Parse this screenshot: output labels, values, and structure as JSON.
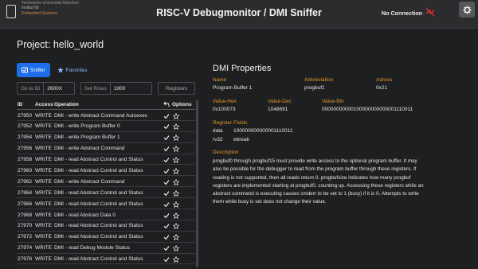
{
  "header": {
    "logo_lines": [
      "Technische Universität München",
      "Institut für",
      "Embedded Systems"
    ],
    "title": "RISC-V Debugmonitor / DMI Sniffer",
    "connection_status": "No Connection",
    "accent_color": "#d63030"
  },
  "project_title": "Project: hello_world",
  "tabs": [
    {
      "label": "Sniffer",
      "icon": "sniffer-icon",
      "active": true
    },
    {
      "label": "Favorites",
      "icon": "star-icon",
      "active": false
    }
  ],
  "controls": {
    "goto_label": "Go to ID",
    "goto_value": "2600X",
    "rows_label": "Set Rows",
    "rows_value": "1000",
    "registers_button": "Registers"
  },
  "table": {
    "headers": {
      "id": "ID",
      "access": "Access",
      "operation": "Operation",
      "options": "Options"
    },
    "rows": [
      {
        "id": "27950",
        "access": "WRITE",
        "op": "DMI - write Abstract Command Autoexec"
      },
      {
        "id": "27952",
        "access": "WRITE",
        "op": "DMI - write Program Buffer 0"
      },
      {
        "id": "27954",
        "access": "WRITE",
        "op": "DMI - write Program Buffer 1"
      },
      {
        "id": "27956",
        "access": "WRITE",
        "op": "DMI - write Abstract Command"
      },
      {
        "id": "27958",
        "access": "WRITE",
        "op": "DMI - read Abstract Control and Status"
      },
      {
        "id": "27960",
        "access": "WRITE",
        "op": "DMI - read Abstract Control and Status"
      },
      {
        "id": "27962",
        "access": "WRITE",
        "op": "DMI - write Abstract Command"
      },
      {
        "id": "27964",
        "access": "WRITE",
        "op": "DMI - read Abstract Control and Status"
      },
      {
        "id": "27966",
        "access": "WRITE",
        "op": "DMI - read Abstract Control and Status"
      },
      {
        "id": "27968",
        "access": "WRITE",
        "op": "DMI - read Abstract Data 0"
      },
      {
        "id": "27970",
        "access": "WRITE",
        "op": "DMI - read Abstract Control and Status"
      },
      {
        "id": "27972",
        "access": "WRITE",
        "op": "DMI - read Abstract Control and Status"
      },
      {
        "id": "27974",
        "access": "WRITE",
        "op": "DMI - read Debug Module Status"
      },
      {
        "id": "27976",
        "access": "WRITE",
        "op": "DMI - read Abstract Control and Status"
      }
    ]
  },
  "props": {
    "title": "DMI Properties",
    "name_label": "Name",
    "name_value": "Program Buffer 1",
    "abbr_label": "Abbreviation",
    "abbr_value": "progbuf1",
    "addr_label": "Adress",
    "addr_value": "0x21",
    "hex_label": "Value-Hex",
    "hex_value": "0x100073",
    "dec_label": "Value-Dec",
    "dec_value": "1048691",
    "bin_label": "Value-Bin",
    "bin_value": "00000000000100000000000001110011",
    "fields_label": "Register Fields",
    "field1_name": "data",
    "field1_value": "100000000000001110011",
    "field2_name": "rv32",
    "field2_value": "ebreak",
    "desc_label": "Description",
    "desc_text": "progbuf0 through progbuf15 must provide write access to the optional program buffer. It may also be possible for the debugger to read from the program buffer through these registers. If reading is not supported, then all reads return 0. progbufsize indicates how many progbuf registers are implemented starting at progbuf0, counting up. Accessing these registers while an abstract command is executing causes cmderr to be set to 1 (busy) if it is 0. Attempts to write them while busy is set does not change their value."
  }
}
